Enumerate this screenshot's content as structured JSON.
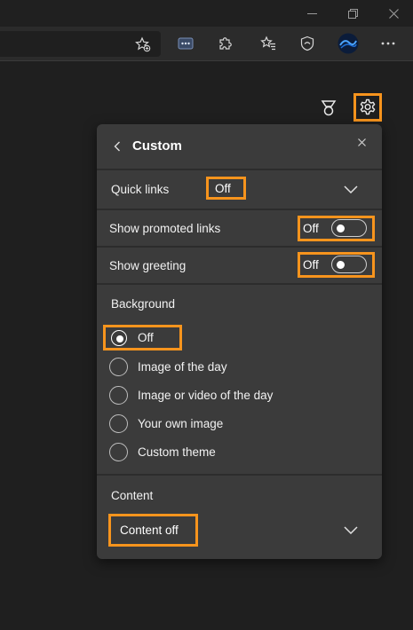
{
  "colors": {
    "highlight": "#f7941d",
    "panel": "#3b3b3b",
    "page": "#1f1f1f"
  },
  "window_controls": [
    "minimize-icon",
    "restore-icon",
    "close-icon"
  ],
  "toolbar": {
    "icons": [
      "favorite-add-icon",
      "extension-dots-icon",
      "extensions-icon",
      "favorites-icon",
      "browser-essentials-icon",
      "profile-avatar-icon",
      "more-icon"
    ]
  },
  "page": {
    "icons": [
      "rewards-medal-icon",
      "gear-icon"
    ]
  },
  "panel": {
    "title": "Custom",
    "quick_links": {
      "label": "Quick links",
      "value": "Off"
    },
    "show_promoted_links": {
      "label": "Show promoted links",
      "value": "Off"
    },
    "show_greeting": {
      "label": "Show greeting",
      "value": "Off"
    },
    "background": {
      "heading": "Background",
      "options": [
        "Off",
        "Image of the day",
        "Image or video of the day",
        "Your own image",
        "Custom theme"
      ],
      "selected": "Off"
    },
    "content": {
      "heading": "Content",
      "value": "Content off"
    }
  }
}
